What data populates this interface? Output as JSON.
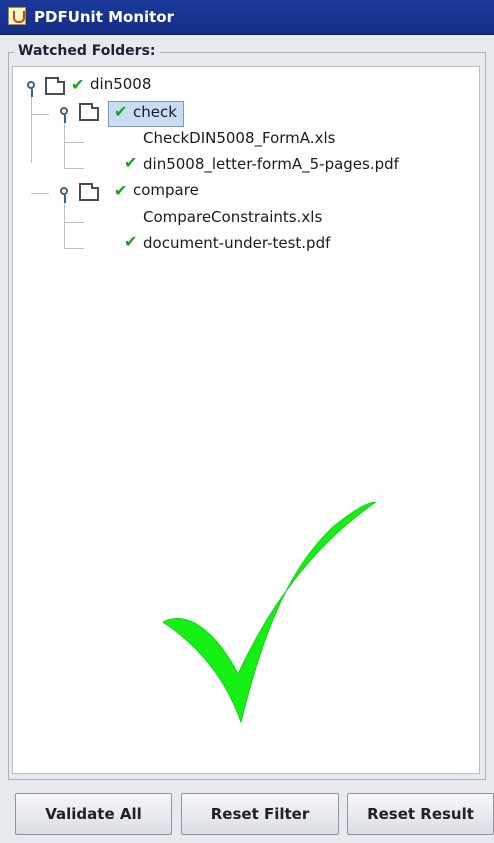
{
  "window": {
    "title": "PDFUnit Monitor"
  },
  "panel": {
    "title": "Watched Folders:"
  },
  "tree": {
    "root": {
      "label": "din5008",
      "children": [
        {
          "label": "check",
          "files": [
            "CheckDIN5008_FormA.xls",
            "din5008_letter-formA_5-pages.pdf"
          ]
        },
        {
          "label": "compare",
          "files": [
            "CompareConstraints.xls",
            "document-under-test.pdf"
          ]
        }
      ]
    }
  },
  "buttons": {
    "validate_all": "Validate All",
    "reset_filter": "Reset Filter",
    "reset_result": "Reset Result"
  },
  "colors": {
    "check_green": "#16a31a",
    "big_check_green": "#14ef14"
  },
  "icons": {
    "tree_handle": "tree-handle-icon",
    "folder": "folder-icon",
    "small_check": "check-icon",
    "big_check": "big-check-icon",
    "app": "java-app-icon"
  }
}
